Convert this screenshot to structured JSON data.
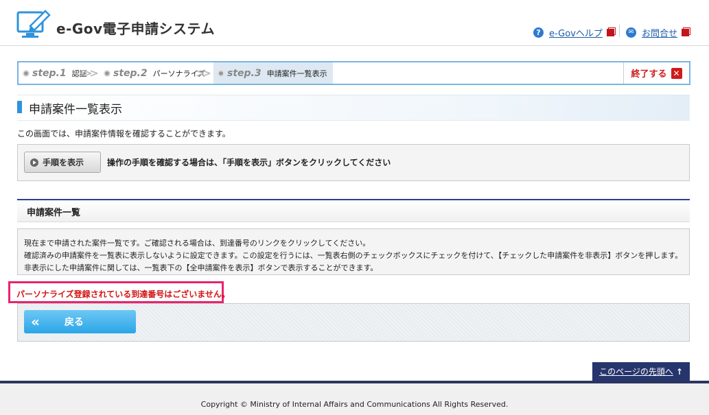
{
  "header": {
    "logo_text": "e-Gov電子申請システム",
    "help_label": "e-Govヘルプ",
    "contact_label": "お問合せ"
  },
  "steps": [
    {
      "num": "step.1",
      "label": "認証"
    },
    {
      "num": "step.2",
      "label": "パーソナライズ"
    },
    {
      "num": "step.3",
      "label": "申請案件一覧表示"
    }
  ],
  "exit_label": "終了する",
  "page_title": "申請案件一覧表示",
  "intro": "この画面では、申請案件情報を確認することができます。",
  "procedure": {
    "button_label": "手順を表示",
    "text": "操作の手順を確認する場合は、「手順を表示」ボタンをクリックしてください"
  },
  "section_title": "申請案件一覧",
  "info_lines": [
    "現在まで申請された案件一覧です。ご確認される場合は、到達番号のリンクをクリックしてください。",
    "確認済みの申請案件を一覧表に表示しないように設定できます。この設定を行うには、一覧表右側のチェックボックスにチェックを付けて、【チェックした申請案件を非表示】ボタンを押します。",
    "非表示にした申請案件に関しては、一覧表下の【全申請案件を表示】ボタンで表示することができます。"
  ],
  "error_message": "パーソナライズ登録されている到達番号はございません。",
  "back_label": "戻る",
  "page_top_label": "このページの先頭へ",
  "copyright": "Copyright © Ministry of Internal Affairs and Communications All Rights Reserved.",
  "colors": {
    "accent_blue": "#2f93dc",
    "error_red": "#d21414",
    "error_border": "#e8236f",
    "navy": "#27356d"
  }
}
